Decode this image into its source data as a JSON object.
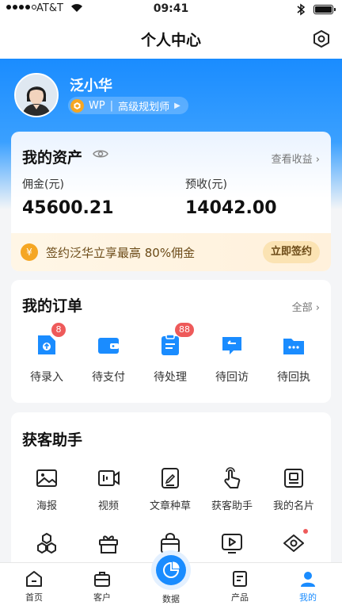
{
  "status_bar": {
    "carrier": "AT&T",
    "time": "09:41"
  },
  "nav": {
    "title": "个人中心",
    "settings_icon": "settings-hex-icon"
  },
  "profile": {
    "name": "泛小华",
    "badge_code": "WP",
    "badge_title": "高级规划师"
  },
  "assets": {
    "title": "我的资产",
    "view_earnings": "查看收益",
    "commission_label": "佣金(元)",
    "commission_value": "45600.21",
    "prepaid_label": "预收(元)",
    "prepaid_value": "14042.00",
    "promo_icon": "¥",
    "promo_text": "签约泛华立享最高 80%佣金",
    "promo_button": "立即签约"
  },
  "orders": {
    "title": "我的订单",
    "all_label": "全部",
    "items": [
      {
        "label": "待录入",
        "badge": "8"
      },
      {
        "label": "待支付",
        "badge": ""
      },
      {
        "label": "待处理",
        "badge": "88"
      },
      {
        "label": "待回访",
        "badge": ""
      },
      {
        "label": "待回执",
        "badge": ""
      }
    ]
  },
  "tools": {
    "title": "获客助手",
    "row1": [
      {
        "label": "海报",
        "icon": "image-icon"
      },
      {
        "label": "视频",
        "icon": "video-icon"
      },
      {
        "label": "文章种草",
        "icon": "article-icon"
      },
      {
        "label": "获客助手",
        "icon": "hand-tap-icon"
      },
      {
        "label": "我的名片",
        "icon": "card-icon"
      }
    ],
    "row2_icons": [
      "hexagons-icon",
      "gift-icon",
      "bag-icon",
      "play-screen-icon",
      "eye-icon"
    ]
  },
  "tabbar": {
    "items": [
      "首页",
      "客户",
      "数据",
      "产品",
      "我的"
    ],
    "active": "我的"
  },
  "colors": {
    "primary": "#1a8cff",
    "badge_red": "#ee5a5a",
    "gold": "#f5a623"
  }
}
